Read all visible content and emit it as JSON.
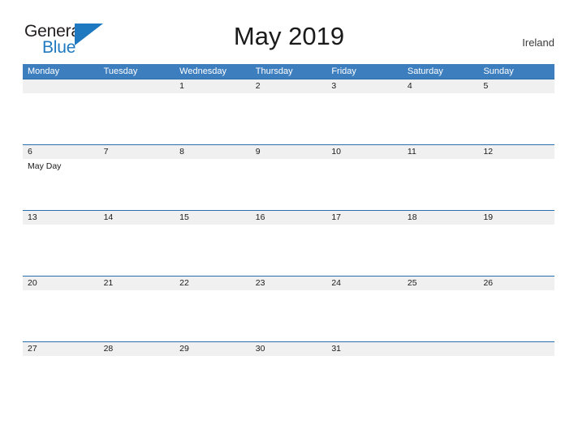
{
  "brand": {
    "name_part1": "General",
    "name_part2": "Blue",
    "flag_icon": "blue-triangle-flag-icon",
    "accent_color": "#1f79c0"
  },
  "header": {
    "title": "May 2019",
    "region": "Ireland"
  },
  "colors": {
    "weekday_header_bg": "#3d7ebf",
    "date_band_bg": "#f0f0f0",
    "date_band_border": "#2a6fad",
    "page_bg": "#ffffff",
    "text": "#1a1a1a"
  },
  "calendar": {
    "month": "May",
    "year": "2019",
    "weekdays": [
      "Monday",
      "Tuesday",
      "Wednesday",
      "Thursday",
      "Friday",
      "Saturday",
      "Sunday"
    ],
    "weeks": [
      [
        {
          "day": "",
          "events": []
        },
        {
          "day": "",
          "events": []
        },
        {
          "day": "1",
          "events": []
        },
        {
          "day": "2",
          "events": []
        },
        {
          "day": "3",
          "events": []
        },
        {
          "day": "4",
          "events": []
        },
        {
          "day": "5",
          "events": []
        }
      ],
      [
        {
          "day": "6",
          "events": [
            "May Day"
          ]
        },
        {
          "day": "7",
          "events": []
        },
        {
          "day": "8",
          "events": []
        },
        {
          "day": "9",
          "events": []
        },
        {
          "day": "10",
          "events": []
        },
        {
          "day": "11",
          "events": []
        },
        {
          "day": "12",
          "events": []
        }
      ],
      [
        {
          "day": "13",
          "events": []
        },
        {
          "day": "14",
          "events": []
        },
        {
          "day": "15",
          "events": []
        },
        {
          "day": "16",
          "events": []
        },
        {
          "day": "17",
          "events": []
        },
        {
          "day": "18",
          "events": []
        },
        {
          "day": "19",
          "events": []
        }
      ],
      [
        {
          "day": "20",
          "events": []
        },
        {
          "day": "21",
          "events": []
        },
        {
          "day": "22",
          "events": []
        },
        {
          "day": "23",
          "events": []
        },
        {
          "day": "24",
          "events": []
        },
        {
          "day": "25",
          "events": []
        },
        {
          "day": "26",
          "events": []
        }
      ],
      [
        {
          "day": "27",
          "events": []
        },
        {
          "day": "28",
          "events": []
        },
        {
          "day": "29",
          "events": []
        },
        {
          "day": "30",
          "events": []
        },
        {
          "day": "31",
          "events": []
        },
        {
          "day": "",
          "events": []
        },
        {
          "day": "",
          "events": []
        }
      ]
    ]
  }
}
